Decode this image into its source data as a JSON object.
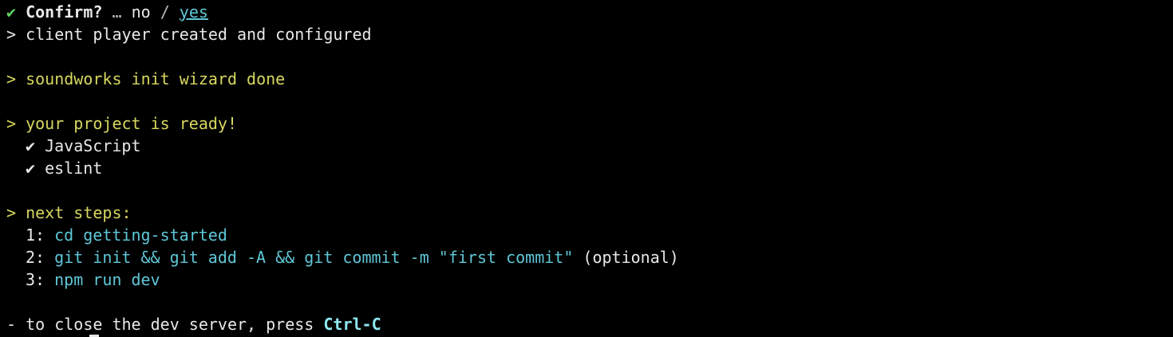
{
  "confirm": {
    "check": "✔",
    "label": "Confirm?",
    "ellipsis": "…",
    "no": "no",
    "slash": "/",
    "yes": "yes"
  },
  "lines": {
    "prompt_symbol": ">",
    "client_created": "client player created and configured",
    "wizard_done": "soundworks init wizard done",
    "project_ready": "your project is ready!",
    "checks": [
      {
        "mark": "✔",
        "label": "JavaScript"
      },
      {
        "mark": "✔",
        "label": "eslint"
      }
    ],
    "next_steps": "next steps:",
    "steps": [
      {
        "num": "1:",
        "command": "cd getting-started",
        "note": ""
      },
      {
        "num": "2:",
        "command": "git init && git add -A && git commit -m \"first commit\"",
        "note": "(optional)"
      },
      {
        "num": "3:",
        "command": "npm run dev",
        "note": ""
      }
    ],
    "close_prefix": "-",
    "close_text": "to close the dev server, press",
    "close_key": "Ctrl-C"
  },
  "colors": {
    "background": "#000000",
    "green": "#5fd35f",
    "yellow": "#d7d75f",
    "cyan": "#5fc7d7",
    "white": "#e8e8e8"
  }
}
